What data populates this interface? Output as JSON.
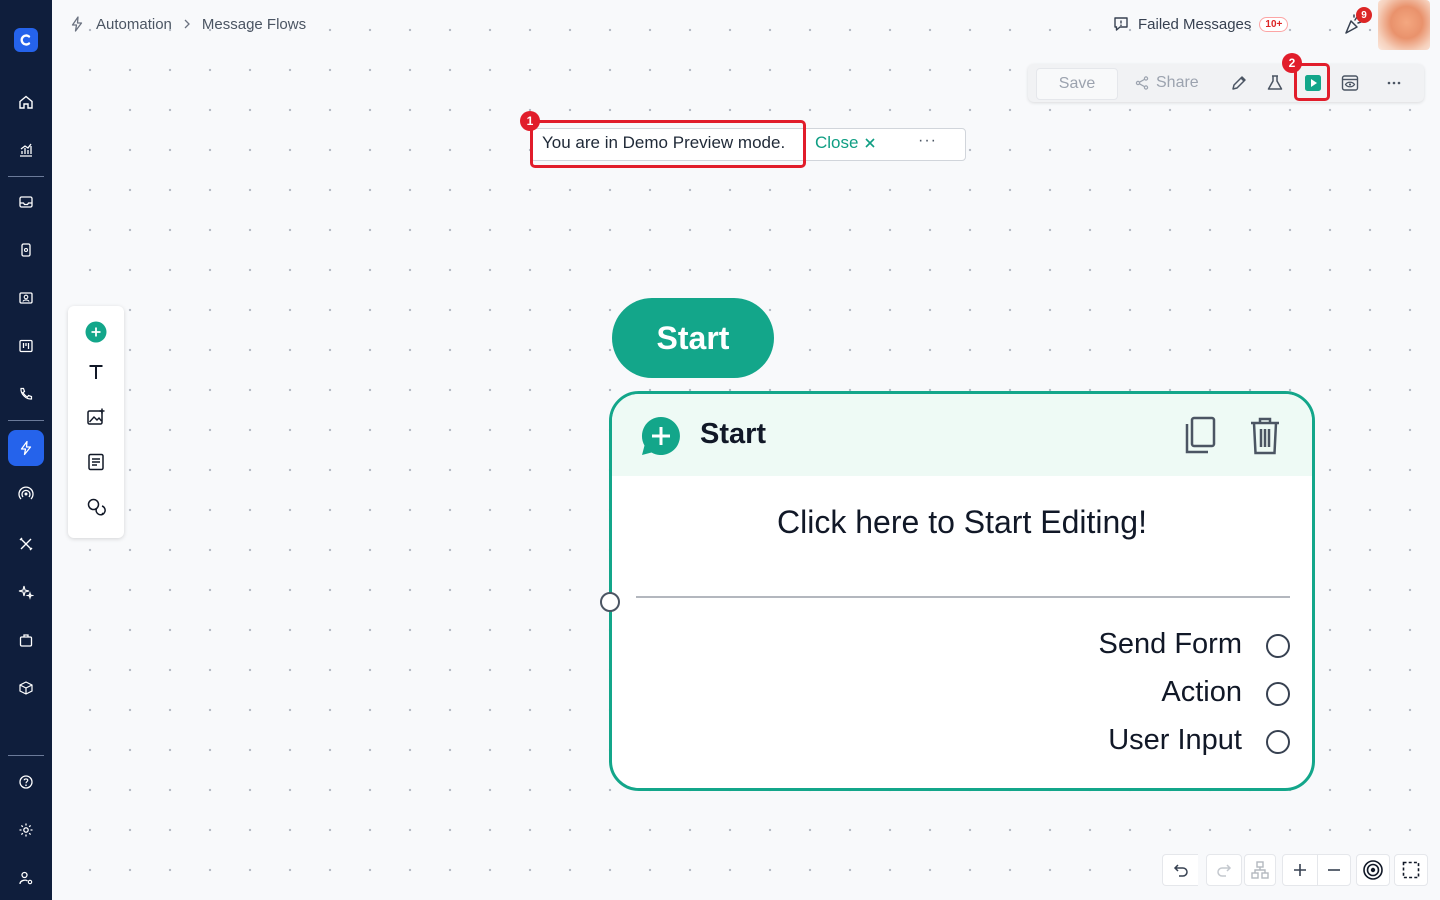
{
  "breadcrumb": {
    "root": "Automation",
    "current": "Message Flows"
  },
  "header": {
    "failed_label": "Failed Messages",
    "failed_badge": "10+",
    "notification_count": "9"
  },
  "toolbar": {
    "save_label": "Save",
    "share_label": "Share",
    "step_marker": "2"
  },
  "demo_banner": {
    "message": "You are in Demo Preview mode.",
    "close_label": "Close",
    "more_label": "···",
    "step_marker": "1"
  },
  "start_pill": {
    "label": "Start"
  },
  "node": {
    "title": "Start",
    "prompt": "Click here to Start Editing!",
    "options": [
      {
        "label": "Send Form"
      },
      {
        "label": "Action"
      },
      {
        "label": "User Input"
      }
    ]
  },
  "colors": {
    "brand_teal": "#13a68a",
    "sidebar_bg": "#0f1e3c",
    "highlight_red": "#e11d2b",
    "active_blue": "#2563eb"
  }
}
